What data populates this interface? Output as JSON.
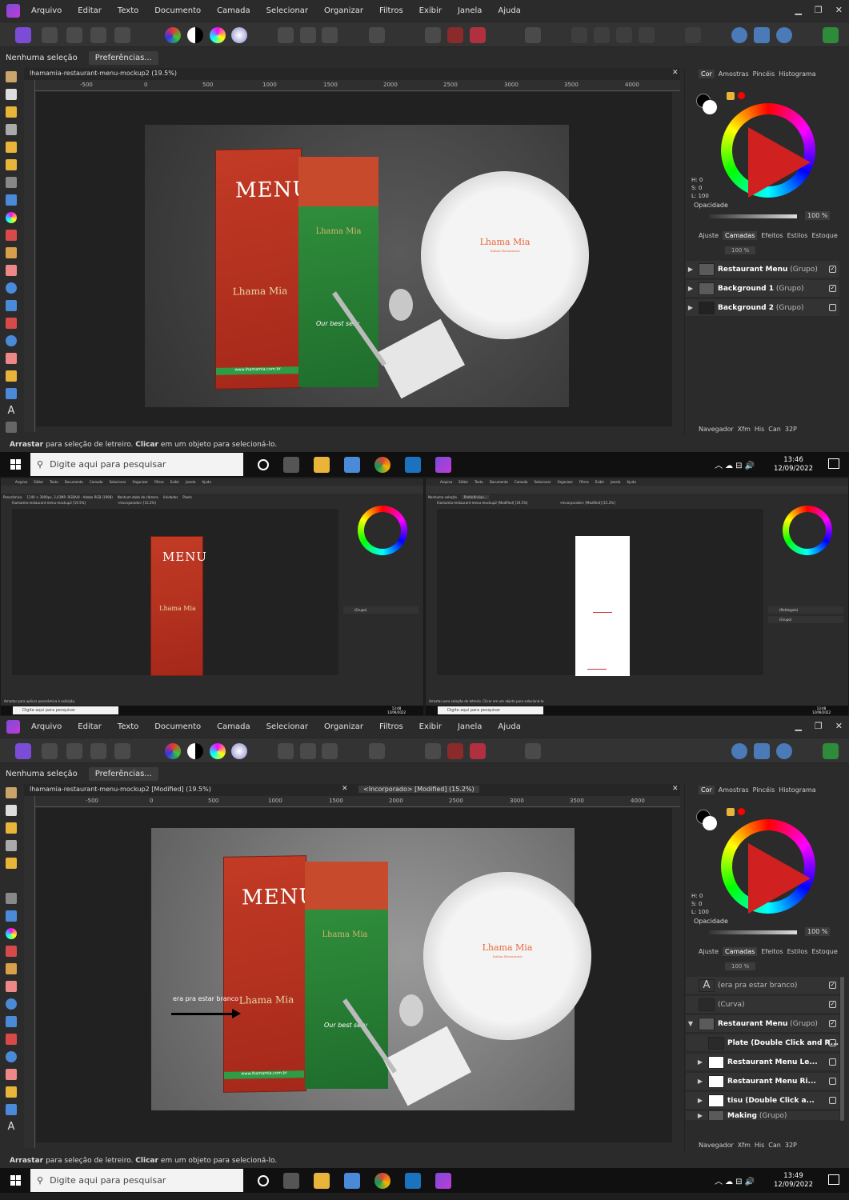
{
  "menu": [
    "Arquivo",
    "Editar",
    "Texto",
    "Documento",
    "Camada",
    "Selecionar",
    "Organizar",
    "Filtros",
    "Exibir",
    "Janela",
    "Ajuda"
  ],
  "context": {
    "selection": "Nenhuma seleção",
    "prefs": "Preferências..."
  },
  "top": {
    "doc_tab": "lhamamia-restaurant-menu-mockup2 (19.5%)",
    "ruler_ticks": [
      "-500",
      "0",
      "500",
      "1000",
      "1500",
      "2000",
      "2500",
      "3000",
      "3500",
      "4000"
    ],
    "ruler_v": [
      "0",
      "500",
      "1000",
      "1500",
      "2000"
    ],
    "panel_tabs": [
      "Cor",
      "Amostras",
      "Pincéis",
      "Histograma"
    ],
    "hsl": "H: 0\nS: 0\nL: 100",
    "opacity_label": "Opacidade",
    "opacity_value": "100 %",
    "layer_tabs": [
      "Ajuste",
      "Camadas",
      "Efeitos",
      "Estilos",
      "Estoque"
    ],
    "layer_opacity": "100 %",
    "layers": [
      {
        "name": "Restaurant Menu",
        "kind": "(Grupo)",
        "checked": true
      },
      {
        "name": "Background 1",
        "kind": "(Grupo)",
        "checked": true
      },
      {
        "name": "Background 2",
        "kind": "(Grupo)",
        "checked": false
      }
    ],
    "bottom_tabs": [
      "Navegador",
      "Xfm",
      "His",
      "Can",
      "32P"
    ],
    "status_bold1": "Arrastar",
    "status_text1": "para seleção de letreiro.",
    "status_bold2": "Clicar",
    "status_text2": "em um objeto para selecioná-lo.",
    "clock_time": "13:46",
    "clock_date": "12/09/2022"
  },
  "mockup": {
    "menu_word": "MENU",
    "brand": "Lhama Mia",
    "sub": "Italian Restaurant",
    "best": "Our best serv",
    "url": "www.lhamamia.com.br"
  },
  "taskbar": {
    "search": "Digite aqui para pesquisar"
  },
  "middle": {
    "left": {
      "ctx": [
        "Panorâmica",
        "1140 × 3000px, 3,43MP, RGBA/8 - Adobe RGB (1998)",
        "Nenhum dado de câmera",
        "Unidades",
        "Pixels"
      ],
      "tabs": [
        "lhamamia-restaurant-menu-mockup2 [19.5%]",
        "<Incorporado> [15.2%]"
      ],
      "layer": "(Grupo)",
      "status": "Arrastar para aplicar panorâmica à exibição.",
      "clock": "13:48\n12/09/2022"
    },
    "right": {
      "ctx": [
        "Nenhuma seleção",
        "Preferências..."
      ],
      "tabs": [
        "lhamamia-restaurant-menu-mockup2 [Modified] [19.5%]",
        "<Incorporado> [Modified] [15.2%]"
      ],
      "layers": [
        "(Retângulo)",
        "(Grupo)"
      ],
      "status": "Arrastar para seleção de letreiro. Clicar em um objeto para selecioná-lo.",
      "clock": "13:48\n12/09/2022"
    }
  },
  "bottom": {
    "doc_tab": "lhamamia-restaurant-menu-mockup2 [Modified] (19.5%)",
    "doc_tab2": "<Incorporado> [Modified] (15.2%)",
    "annotation": "era pra estar branco",
    "layers": [
      {
        "name": "",
        "kind": "(era pra estar branco)",
        "checked": true,
        "icon": "A"
      },
      {
        "name": "",
        "kind": "(Curva)",
        "checked": true,
        "icon": ""
      },
      {
        "name": "Restaurant Menu",
        "kind": "(Grupo)",
        "checked": true,
        "icon": ""
      },
      {
        "name": "Plate (Double Click and R...",
        "kind": "",
        "checked": false,
        "icon": ""
      },
      {
        "name": "Restaurant Menu Le...",
        "kind": "",
        "checked": false,
        "icon": ""
      },
      {
        "name": "Restaurant Menu Ri...",
        "kind": "",
        "checked": false,
        "icon": ""
      },
      {
        "name": "tisu (Double Click a...",
        "kind": "",
        "checked": false,
        "icon": ""
      },
      {
        "name": "Making",
        "kind": "(Grupo)",
        "checked": true,
        "icon": ""
      }
    ],
    "clock_time": "13:49",
    "clock_date": "12/09/2022"
  }
}
